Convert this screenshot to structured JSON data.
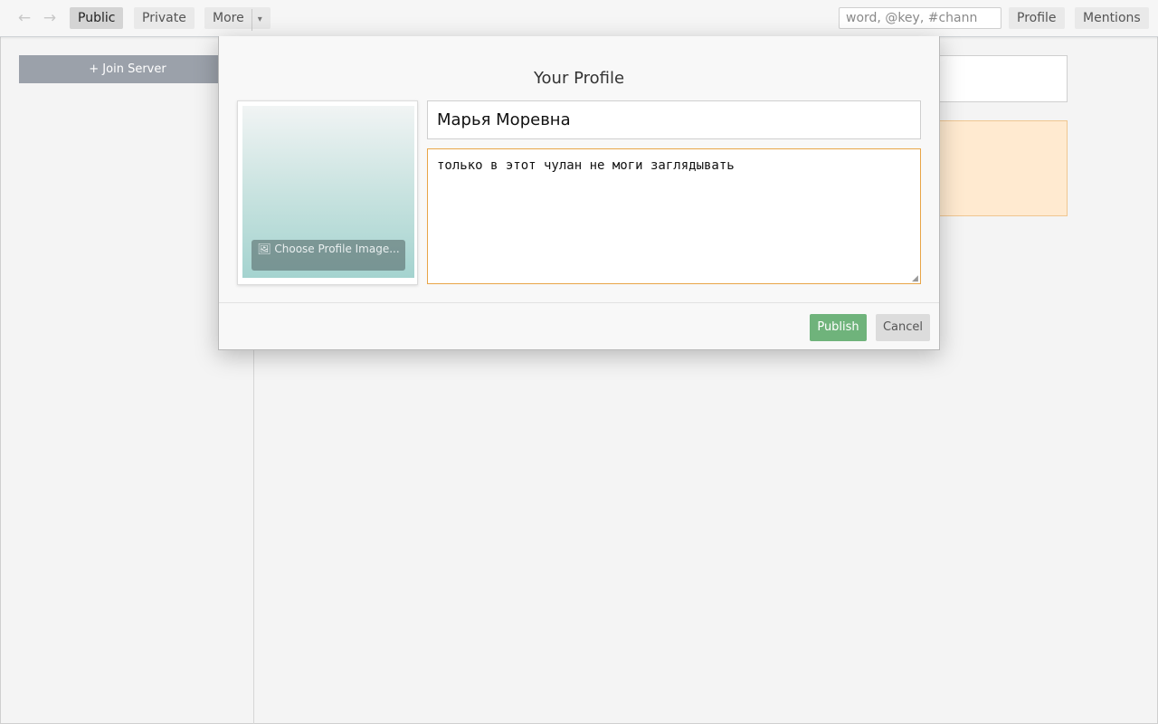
{
  "topbar": {
    "back_icon": "arrow-left-icon",
    "forward_icon": "arrow-right-icon",
    "tabs": [
      {
        "label": "Public",
        "active": true
      },
      {
        "label": "Private",
        "active": false
      }
    ],
    "more_label": "More",
    "more_caret": "▾",
    "search_placeholder": "word, @key, #chann",
    "profile_label": "Profile",
    "mentions_label": "Mentions"
  },
  "sidebar": {
    "join_label": "+ Join Server"
  },
  "modal": {
    "title": "Your Profile",
    "choose_image_icon": "image-icon",
    "choose_image_glyph": "🖼",
    "choose_image_label": "Choose Profile Image...",
    "name_value": "Марья Моревна",
    "about_value": "только в этот чулан не моги заглядывать",
    "publish_label": "Publish",
    "cancel_label": "Cancel"
  },
  "colors": {
    "publish": "#6fb37b",
    "focus_border": "#e8a547",
    "warning_bg": "#ffead0",
    "join_button": "#9ba1aa"
  }
}
